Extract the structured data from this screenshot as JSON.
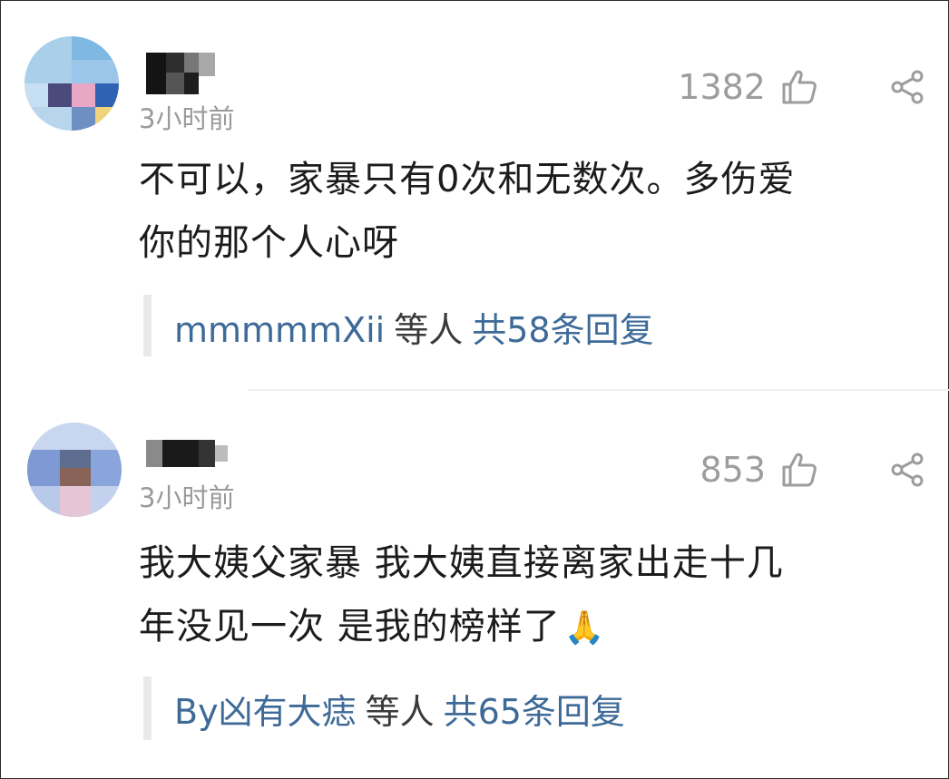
{
  "comments": [
    {
      "time": "3小时前",
      "likes": "1382",
      "content_line1": "不可以，家暴只有0次和无数次。多伤爱",
      "content_line2": "你的那个人心呀",
      "emoji": "",
      "reply": {
        "user": "mmmmmXii",
        "etc": "等人",
        "count": "共58条回复"
      }
    },
    {
      "time": "3小时前",
      "likes": "853",
      "content_line1": "我大姨父家暴 我大姨直接离家出走十几",
      "content_line2": "年没见一次 是我的榜样了",
      "emoji": "🙏",
      "reply": {
        "user": "By凶有大痣",
        "etc": "等人",
        "count": "共65条回复"
      }
    }
  ],
  "icons": {
    "like": "thumbs-up-icon",
    "share": "share-icon"
  },
  "colors": {
    "link": "#3e6a98",
    "meta": "#9a9a9a",
    "text": "#1c1c1c"
  }
}
